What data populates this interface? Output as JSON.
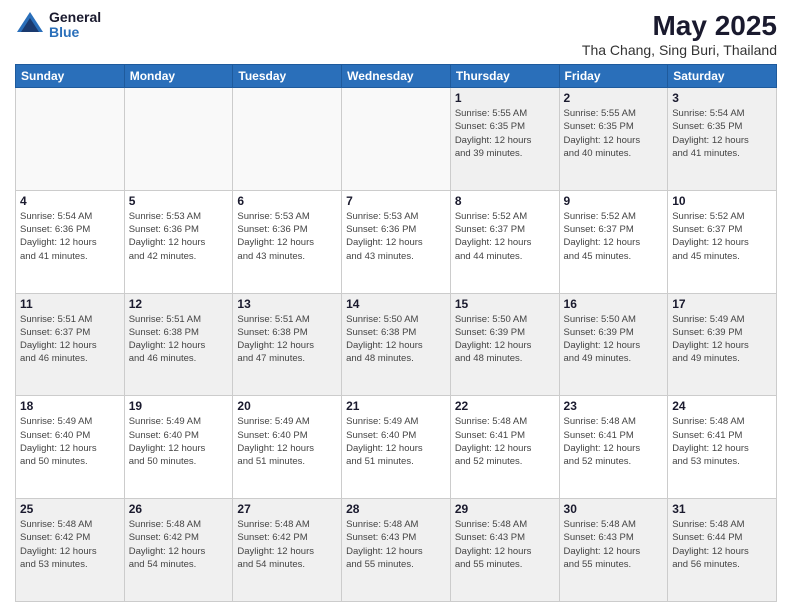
{
  "header": {
    "logo_general": "General",
    "logo_blue": "Blue",
    "title": "May 2025",
    "subtitle": "Tha Chang, Sing Buri, Thailand"
  },
  "days_of_week": [
    "Sunday",
    "Monday",
    "Tuesday",
    "Wednesday",
    "Thursday",
    "Friday",
    "Saturday"
  ],
  "weeks": [
    [
      {
        "day": "",
        "info": ""
      },
      {
        "day": "",
        "info": ""
      },
      {
        "day": "",
        "info": ""
      },
      {
        "day": "",
        "info": ""
      },
      {
        "day": "1",
        "info": "Sunrise: 5:55 AM\nSunset: 6:35 PM\nDaylight: 12 hours\nand 39 minutes."
      },
      {
        "day": "2",
        "info": "Sunrise: 5:55 AM\nSunset: 6:35 PM\nDaylight: 12 hours\nand 40 minutes."
      },
      {
        "day": "3",
        "info": "Sunrise: 5:54 AM\nSunset: 6:35 PM\nDaylight: 12 hours\nand 41 minutes."
      }
    ],
    [
      {
        "day": "4",
        "info": "Sunrise: 5:54 AM\nSunset: 6:36 PM\nDaylight: 12 hours\nand 41 minutes."
      },
      {
        "day": "5",
        "info": "Sunrise: 5:53 AM\nSunset: 6:36 PM\nDaylight: 12 hours\nand 42 minutes."
      },
      {
        "day": "6",
        "info": "Sunrise: 5:53 AM\nSunset: 6:36 PM\nDaylight: 12 hours\nand 43 minutes."
      },
      {
        "day": "7",
        "info": "Sunrise: 5:53 AM\nSunset: 6:36 PM\nDaylight: 12 hours\nand 43 minutes."
      },
      {
        "day": "8",
        "info": "Sunrise: 5:52 AM\nSunset: 6:37 PM\nDaylight: 12 hours\nand 44 minutes."
      },
      {
        "day": "9",
        "info": "Sunrise: 5:52 AM\nSunset: 6:37 PM\nDaylight: 12 hours\nand 45 minutes."
      },
      {
        "day": "10",
        "info": "Sunrise: 5:52 AM\nSunset: 6:37 PM\nDaylight: 12 hours\nand 45 minutes."
      }
    ],
    [
      {
        "day": "11",
        "info": "Sunrise: 5:51 AM\nSunset: 6:37 PM\nDaylight: 12 hours\nand 46 minutes."
      },
      {
        "day": "12",
        "info": "Sunrise: 5:51 AM\nSunset: 6:38 PM\nDaylight: 12 hours\nand 46 minutes."
      },
      {
        "day": "13",
        "info": "Sunrise: 5:51 AM\nSunset: 6:38 PM\nDaylight: 12 hours\nand 47 minutes."
      },
      {
        "day": "14",
        "info": "Sunrise: 5:50 AM\nSunset: 6:38 PM\nDaylight: 12 hours\nand 48 minutes."
      },
      {
        "day": "15",
        "info": "Sunrise: 5:50 AM\nSunset: 6:39 PM\nDaylight: 12 hours\nand 48 minutes."
      },
      {
        "day": "16",
        "info": "Sunrise: 5:50 AM\nSunset: 6:39 PM\nDaylight: 12 hours\nand 49 minutes."
      },
      {
        "day": "17",
        "info": "Sunrise: 5:49 AM\nSunset: 6:39 PM\nDaylight: 12 hours\nand 49 minutes."
      }
    ],
    [
      {
        "day": "18",
        "info": "Sunrise: 5:49 AM\nSunset: 6:40 PM\nDaylight: 12 hours\nand 50 minutes."
      },
      {
        "day": "19",
        "info": "Sunrise: 5:49 AM\nSunset: 6:40 PM\nDaylight: 12 hours\nand 50 minutes."
      },
      {
        "day": "20",
        "info": "Sunrise: 5:49 AM\nSunset: 6:40 PM\nDaylight: 12 hours\nand 51 minutes."
      },
      {
        "day": "21",
        "info": "Sunrise: 5:49 AM\nSunset: 6:40 PM\nDaylight: 12 hours\nand 51 minutes."
      },
      {
        "day": "22",
        "info": "Sunrise: 5:48 AM\nSunset: 6:41 PM\nDaylight: 12 hours\nand 52 minutes."
      },
      {
        "day": "23",
        "info": "Sunrise: 5:48 AM\nSunset: 6:41 PM\nDaylight: 12 hours\nand 52 minutes."
      },
      {
        "day": "24",
        "info": "Sunrise: 5:48 AM\nSunset: 6:41 PM\nDaylight: 12 hours\nand 53 minutes."
      }
    ],
    [
      {
        "day": "25",
        "info": "Sunrise: 5:48 AM\nSunset: 6:42 PM\nDaylight: 12 hours\nand 53 minutes."
      },
      {
        "day": "26",
        "info": "Sunrise: 5:48 AM\nSunset: 6:42 PM\nDaylight: 12 hours\nand 54 minutes."
      },
      {
        "day": "27",
        "info": "Sunrise: 5:48 AM\nSunset: 6:42 PM\nDaylight: 12 hours\nand 54 minutes."
      },
      {
        "day": "28",
        "info": "Sunrise: 5:48 AM\nSunset: 6:43 PM\nDaylight: 12 hours\nand 55 minutes."
      },
      {
        "day": "29",
        "info": "Sunrise: 5:48 AM\nSunset: 6:43 PM\nDaylight: 12 hours\nand 55 minutes."
      },
      {
        "day": "30",
        "info": "Sunrise: 5:48 AM\nSunset: 6:43 PM\nDaylight: 12 hours\nand 55 minutes."
      },
      {
        "day": "31",
        "info": "Sunrise: 5:48 AM\nSunset: 6:44 PM\nDaylight: 12 hours\nand 56 minutes."
      }
    ]
  ]
}
